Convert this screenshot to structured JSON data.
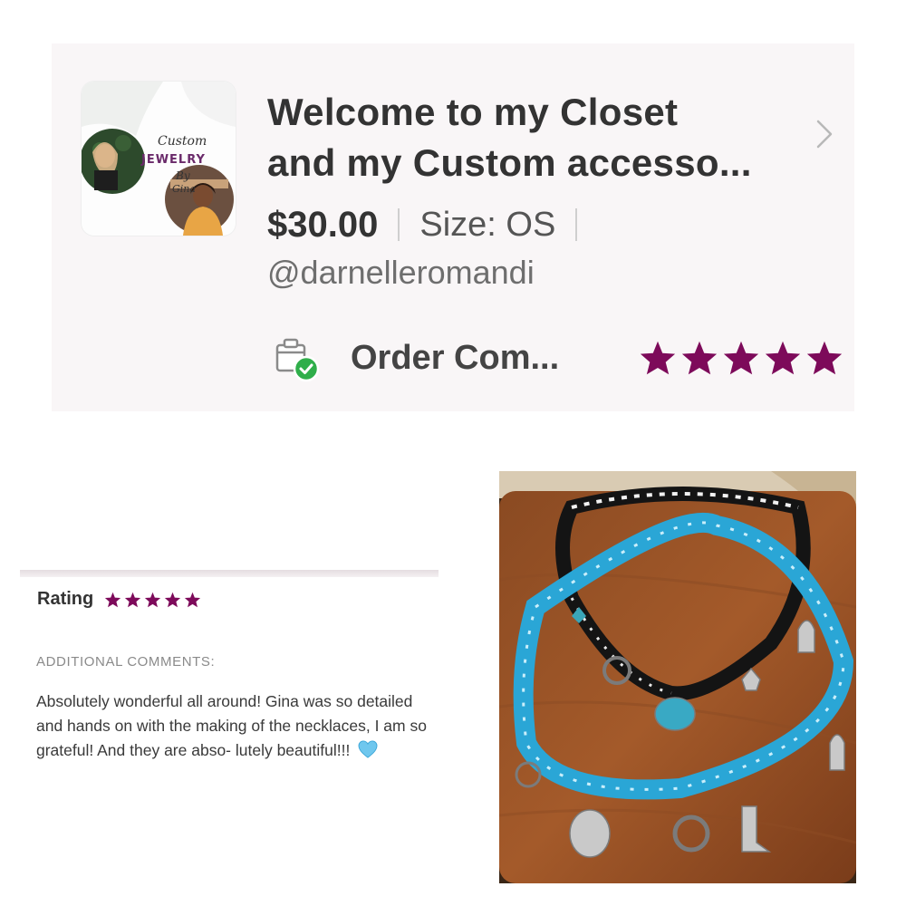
{
  "listing": {
    "title_line1": "Welcome to my Closet",
    "title_line2": "and my Custom accesso...",
    "price": "$30.00",
    "size": "Size: OS",
    "seller": "@darnelleromandi",
    "order_status": "Order Com...",
    "rating_stars": 5,
    "thumbnail": {
      "text_custom": "Custom",
      "text_jewelry": "JEWELRY",
      "text_by": "By",
      "text_gina": "Gina"
    }
  },
  "review": {
    "rating_label": "Rating",
    "rating_stars": 5,
    "comments_heading": "ADDITIONAL COMMENTS:",
    "comment_text": "Absolutely wonderful all around! Gina was so detailed and hands on with the making of the necklaces, I am so grateful! And they are abso- lutely beautiful!!!"
  },
  "colors": {
    "star": "#7d0a5a",
    "card_bg": "#f9f6f7",
    "check_green": "#2fae4a",
    "heart": "#6fc7ee"
  },
  "icons": {
    "chevron": "chevron-right-icon",
    "order": "order-complete-box-icon",
    "star": "star-icon",
    "heart": "light-blue-heart-emoji"
  }
}
